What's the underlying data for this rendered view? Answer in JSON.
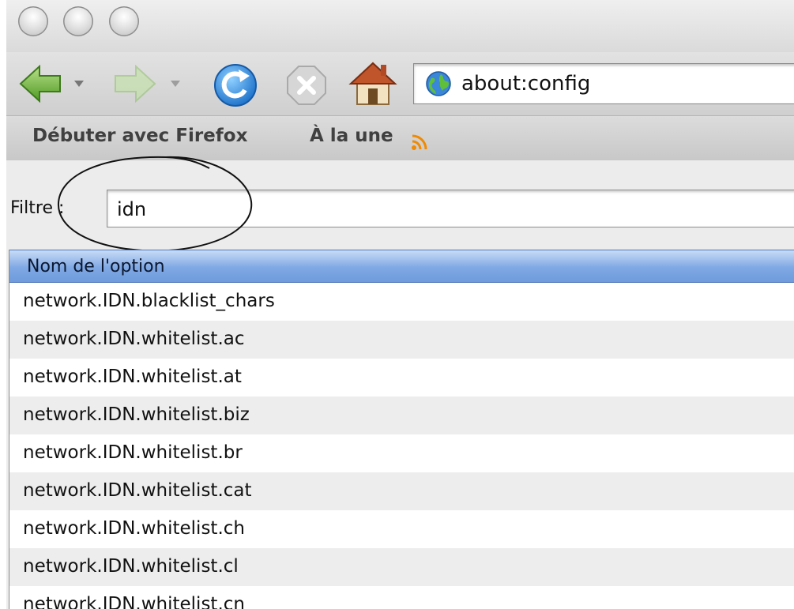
{
  "address_bar": {
    "url": "about:config"
  },
  "bookmarks": [
    {
      "label": "Débuter avec Firefox"
    },
    {
      "label": "À la une"
    }
  ],
  "filter": {
    "label": "Filtre :",
    "value": "idn"
  },
  "table": {
    "column_header": "Nom de l'option",
    "rows": [
      "network.IDN.blacklist_chars",
      "network.IDN.whitelist.ac",
      "network.IDN.whitelist.at",
      "network.IDN.whitelist.biz",
      "network.IDN.whitelist.br",
      "network.IDN.whitelist.cat",
      "network.IDN.whitelist.ch",
      "network.IDN.whitelist.cl",
      "network.IDN.whitelist.cn"
    ]
  },
  "colors": {
    "header_blue": "#7fa8e3",
    "row_alt": "#ededed",
    "rss_orange": "#f08a00"
  },
  "icons": [
    "back-arrow-icon",
    "forward-arrow-icon",
    "reload-icon",
    "stop-icon",
    "home-icon",
    "globe-icon",
    "rss-feed-icon"
  ]
}
